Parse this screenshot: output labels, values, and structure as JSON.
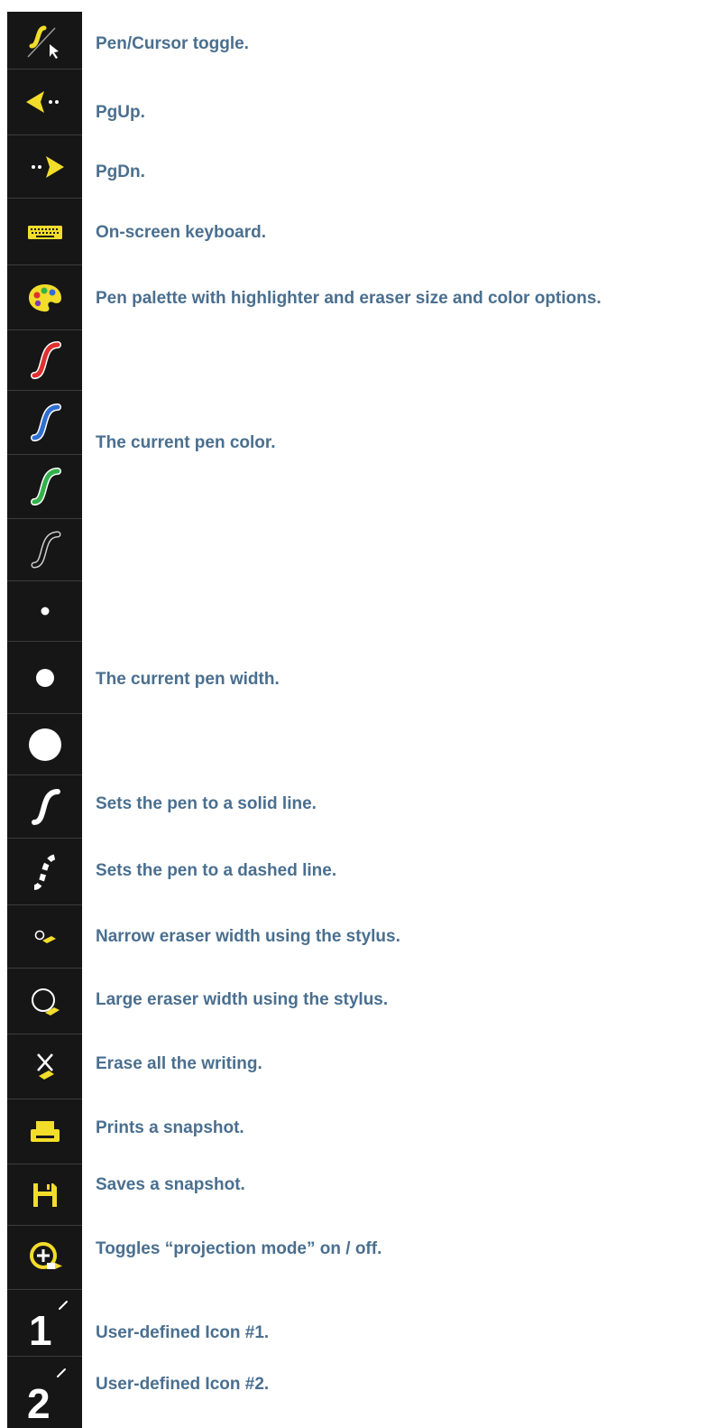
{
  "descriptions": {
    "pen_cursor": "Pen/Cursor toggle.",
    "pgup": "PgUp.",
    "pgdn": "PgDn.",
    "keyboard": "On-screen keyboard.",
    "palette": "Pen palette with highlighter and eraser size and color options.",
    "pen_color": "The current pen color.",
    "pen_width": "The current pen width.",
    "solid": "Sets the pen to a solid line.",
    "dashed": "Sets the pen to a dashed line.",
    "eraser_narrow": "Narrow eraser width using the stylus.",
    "eraser_large": "Large eraser width using the stylus.",
    "erase_all": "Erase all the writing.",
    "print": "Prints a snapshot.",
    "save": "Saves a snapshot.",
    "projection": "Toggles “projection mode” on / off.",
    "user1": "User-defined Icon #1.",
    "user2": "User-defined Icon #2."
  },
  "icons": {
    "user1_number": "1",
    "user2_number": "2"
  },
  "colors": {
    "toolbar_bg": "#161616",
    "icon_yellow": "#f2dd2a",
    "pen_red": "#e03030",
    "pen_blue": "#2f6fd0",
    "pen_green": "#33b24a",
    "text_blue": "#4a6f8f"
  }
}
